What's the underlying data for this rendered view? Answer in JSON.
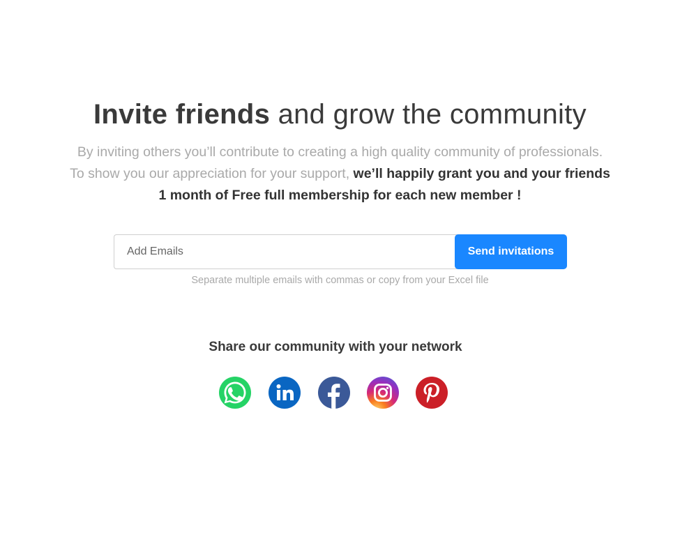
{
  "heading": {
    "bold": "Invite friends",
    "rest": "and grow the community"
  },
  "description": {
    "line1": "By inviting others you’ll contribute to creating a high quality community of professionals.",
    "line2_plain": "To show you our appreciation for your support,",
    "line2_bold": "we’ll happily grant you and your friends",
    "line3_bold": "1 month of Free full membership for each new member !"
  },
  "invite": {
    "placeholder": "Add Emails",
    "button_label": "Send invitations",
    "hint": "Separate multiple emails with commas or copy from your Excel file"
  },
  "share": {
    "title": "Share our community with your network",
    "networks": [
      "whatsapp-icon",
      "linkedin-icon",
      "facebook-icon",
      "instagram-icon",
      "pinterest-icon"
    ]
  },
  "colors": {
    "accent": "#1a87ff",
    "whatsapp": "#25d366",
    "linkedin": "#0a66c2",
    "facebook": "#3b5998",
    "pinterest": "#cb1f27"
  }
}
